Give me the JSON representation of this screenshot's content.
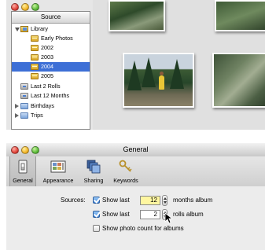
{
  "source_window": {
    "source_header": "Source",
    "library": {
      "label": "Library",
      "albums": [
        "Early Photos",
        "2002",
        "2003",
        "2004",
        "2005"
      ],
      "selected": "2004"
    },
    "smart_albums": [
      "Last 2 Rolls",
      "Last 12 Months"
    ],
    "folders": [
      "Birthdays",
      "Trips"
    ]
  },
  "prefs_window": {
    "title": "General",
    "toolbar": {
      "items": [
        {
          "label": "General",
          "icon": "light-switch-icon",
          "selected": true
        },
        {
          "label": "Appearance",
          "icon": "appearance-icon",
          "selected": false
        },
        {
          "label": "Sharing",
          "icon": "sharing-icon",
          "selected": false
        },
        {
          "label": "Keywords",
          "icon": "keys-icon",
          "selected": false
        }
      ]
    },
    "sources": {
      "label": "Sources:",
      "row1": {
        "checkbox_label": "Show last",
        "value": "12",
        "suffix": "months album",
        "checked": true
      },
      "row2": {
        "checkbox_label": "Show last",
        "value": "2",
        "suffix": "rolls album",
        "checked": true
      },
      "row3": {
        "checkbox_label": "Show photo count for albums",
        "checked": false
      }
    }
  },
  "colors": {
    "selection": "#3d6fd6",
    "field_highlight": "#fff6a0",
    "close": "#e0443a",
    "minimize": "#f2b62a",
    "zoom": "#5dbb3a"
  }
}
